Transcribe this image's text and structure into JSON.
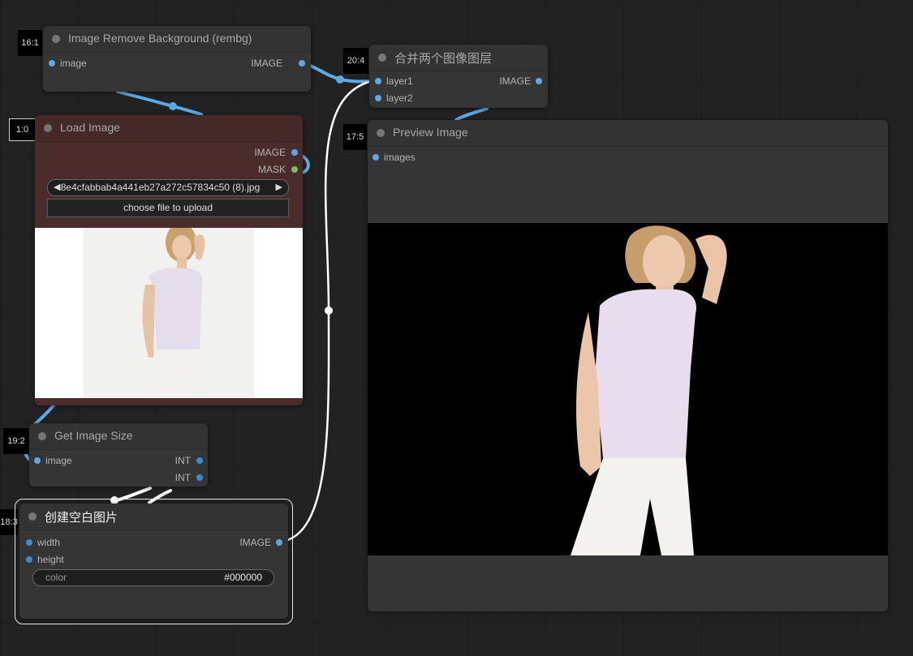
{
  "nodes": {
    "rembg": {
      "id": "16:1",
      "title": "Image Remove Background (rembg)",
      "input": "image",
      "output": "IMAGE"
    },
    "merge": {
      "id": "20:4",
      "title": "合并两个图像图层",
      "input1": "layer1",
      "input2": "layer2",
      "output": "IMAGE"
    },
    "load_image": {
      "id": "1:0",
      "title": "Load Image",
      "output_image": "IMAGE",
      "output_mask": "MASK",
      "filename": "8e4cfabbab4a441eb27a272c57834c50 (8).jpg",
      "upload_label": "choose file to upload"
    },
    "preview": {
      "id": "17:5",
      "title": "Preview Image",
      "input": "images"
    },
    "size": {
      "id": "19:2",
      "title": "Get Image Size",
      "input": "image",
      "output1": "INT",
      "output2": "INT"
    },
    "blank": {
      "id": "18:3",
      "title": "创建空白图片",
      "input_width": "width",
      "input_height": "height",
      "output": "IMAGE",
      "color_label": "color",
      "color_value": "#000000"
    }
  },
  "colors": {
    "canvas_bg": "#222222",
    "node_bg": "#353535",
    "load_image_bg": "#4a2c2c",
    "link_blue": "#5ea8e6",
    "link_white": "#ffffff"
  }
}
